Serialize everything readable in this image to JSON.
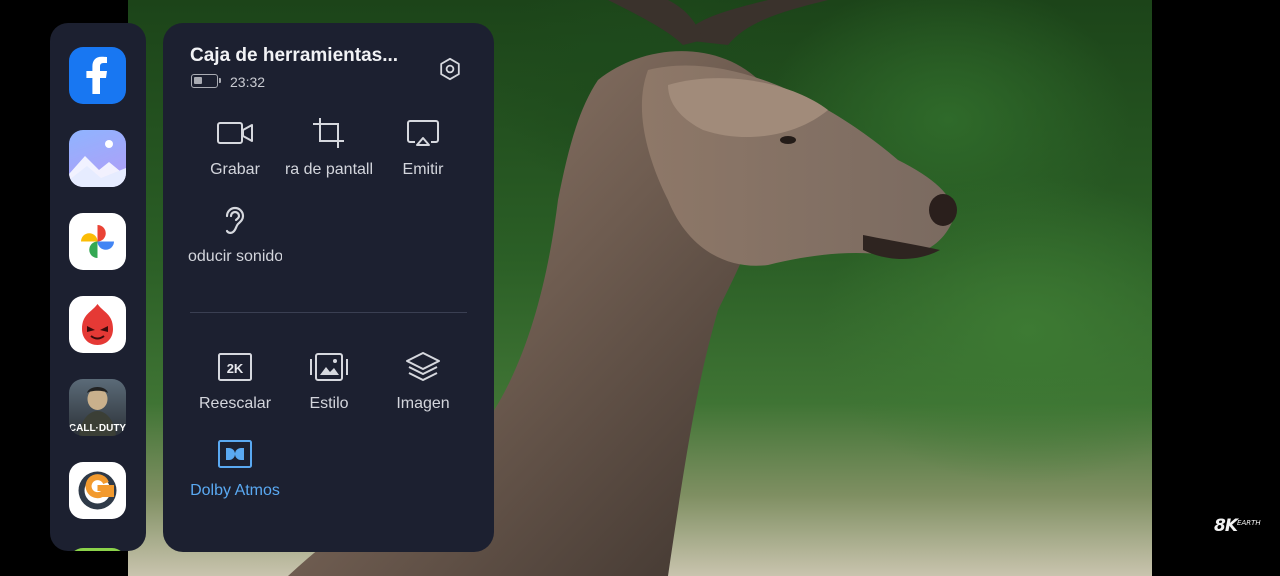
{
  "dock": {
    "apps": [
      {
        "name": "Facebook",
        "icon": "facebook-icon"
      },
      {
        "name": "Gallery",
        "icon": "gallery-icon"
      },
      {
        "name": "Google Photos",
        "icon": "google-photos-icon"
      },
      {
        "name": "AnTuTu",
        "icon": "antutu-icon"
      },
      {
        "name": "Call of Duty",
        "icon": "call-of-duty-icon",
        "label": "CALL·DUTY"
      },
      {
        "name": "G app",
        "icon": "g-app-icon"
      }
    ]
  },
  "toolbox": {
    "title": "Caja de herramientas...",
    "time": "23:32",
    "battery_level": 0.4,
    "settings_icon": "gear-icon",
    "tools_top": [
      {
        "label": "Grabar",
        "icon": "video-record-icon"
      },
      {
        "label": "ra de pantall",
        "icon": "screenshot-crop-icon"
      },
      {
        "label": "Emitir",
        "icon": "cast-icon"
      },
      {
        "label": "oducir sonido",
        "icon": "ear-icon"
      }
    ],
    "tools_bottom": [
      {
        "label": "Reescalar",
        "icon": "2k-icon",
        "badge": "2K"
      },
      {
        "label": "Estilo",
        "icon": "image-style-icon"
      },
      {
        "label": "Imagen",
        "icon": "layers-icon"
      },
      {
        "label": "Dolby Atmos",
        "icon": "dolby-icon",
        "active": true
      }
    ]
  },
  "watermark": {
    "main": "8K",
    "sub": "EARTH"
  },
  "colors": {
    "panel": "#1c2030",
    "accent": "#5aa9f2",
    "facebook": "#1877f2"
  }
}
